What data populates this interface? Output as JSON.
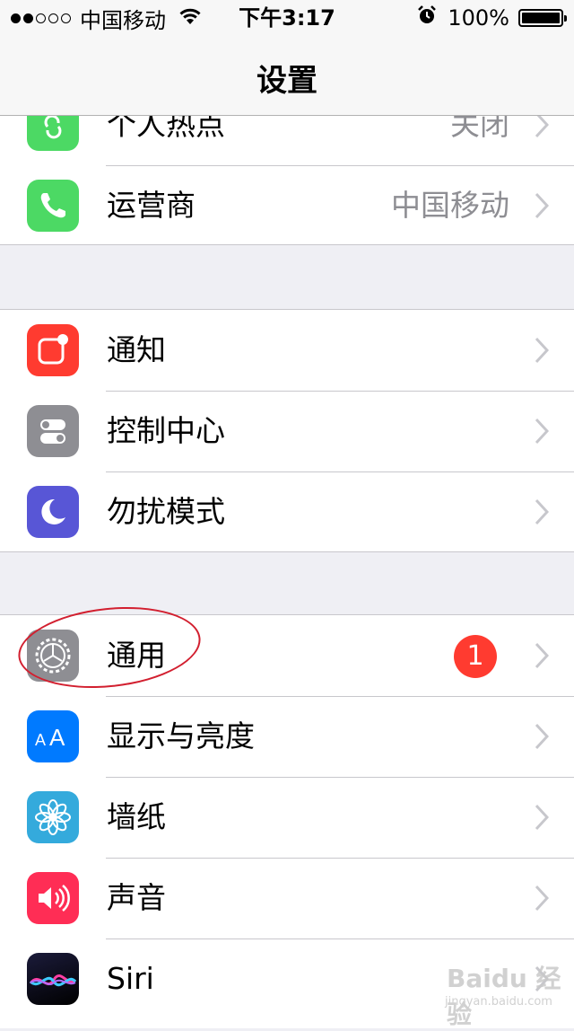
{
  "status_bar": {
    "carrier": "中国移动",
    "time": "下午3:17",
    "battery": "100%",
    "signal_bars_filled": 2,
    "signal_bars_total": 5
  },
  "nav": {
    "title": "设置"
  },
  "groups": [
    {
      "rows": [
        {
          "label": "个人热点",
          "value": "关闭",
          "icon": "personal-hotspot-icon",
          "color": "#4cd964"
        },
        {
          "label": "运营商",
          "value": "中国移动",
          "icon": "phone-icon",
          "color": "#4cd964"
        }
      ]
    },
    {
      "rows": [
        {
          "label": "通知",
          "icon": "notifications-icon",
          "color": "#ff3b30"
        },
        {
          "label": "控制中心",
          "icon": "control-center-icon",
          "color": "#8e8e93"
        },
        {
          "label": "勿扰模式",
          "icon": "moon-icon",
          "color": "#5856d6"
        }
      ]
    },
    {
      "rows": [
        {
          "label": "通用",
          "badge": "1",
          "icon": "gear-icon",
          "color": "#8e8e93"
        },
        {
          "label": "显示与亮度",
          "icon": "text-size-icon",
          "color": "#007aff"
        },
        {
          "label": "墙纸",
          "icon": "flower-icon",
          "color": "#34aadc"
        },
        {
          "label": "声音",
          "icon": "speaker-icon",
          "color": "#ff2d55"
        },
        {
          "label": "Siri",
          "icon": "siri-icon",
          "color": "#000000"
        }
      ]
    }
  ],
  "watermark": {
    "brand": "Baidu 经验",
    "url": "jingyan.baidu.com"
  }
}
